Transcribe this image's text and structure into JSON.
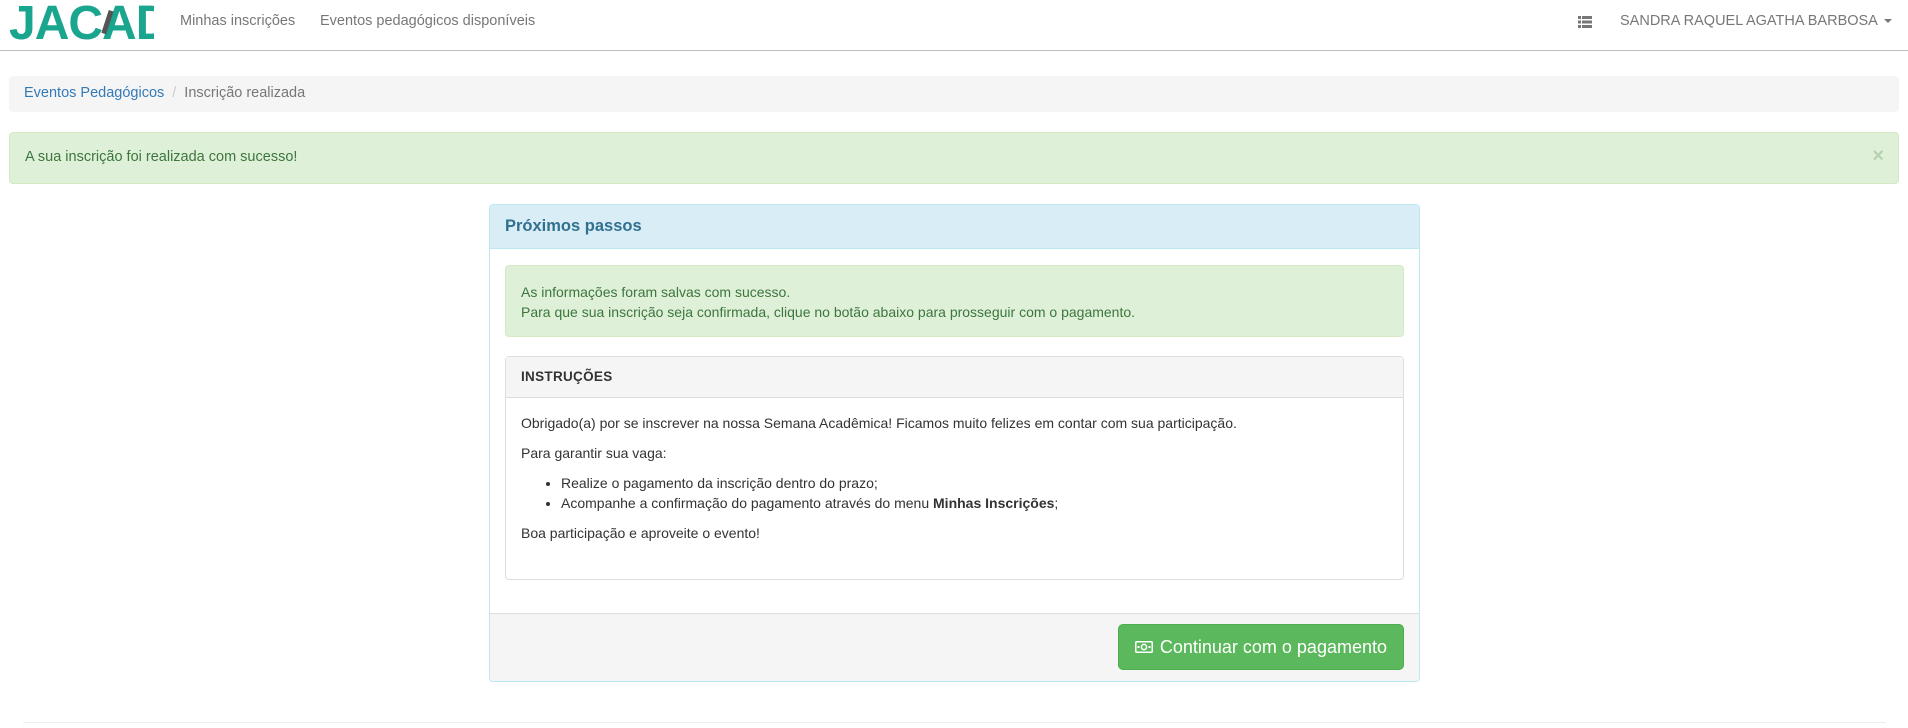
{
  "navbar": {
    "logo_text": "JACAD",
    "links": [
      {
        "label": "Minhas inscrições"
      },
      {
        "label": "Eventos pedagógicos disponíveis"
      }
    ],
    "list_icon": "list-icon",
    "user_name": "SANDRA RAQUEL AGATHA BARBOSA"
  },
  "breadcrumb": {
    "link": "Eventos Pedagógicos",
    "separator": "/",
    "active": "Inscrição realizada"
  },
  "alert_top": {
    "message": "A sua inscrição foi realizada com sucesso!",
    "close": "×"
  },
  "panel": {
    "title": "Próximos passos",
    "info_line_1": "As informações foram salvas com sucesso.",
    "info_line_2": "Para que sua inscrição seja confirmada, clique no botão abaixo para prosseguir com o pagamento.",
    "instructions": {
      "title": "INSTRUÇÕES",
      "intro": "Obrigado(a) por se inscrever na nossa Semana Acadêmica! Ficamos muito felizes em contar com sua participação.",
      "lead": "Para garantir sua vaga:",
      "item_1": "Realize o pagamento da inscrição dentro do prazo;",
      "item_2_prefix": "Acompanhe a confirmação do pagamento através do menu ",
      "item_2_bold": "Minhas Inscrições",
      "item_2_suffix": ";",
      "closing": "Boa participação e aproveite o evento!"
    },
    "button_label": "Continuar com o pagamento",
    "button_icon": "money-icon"
  },
  "colors": {
    "brand": "#1aa58f",
    "success_bg": "#dff0d8",
    "success_text": "#3c763d",
    "info_bg": "#d9edf7",
    "info_text": "#31708f",
    "button_green": "#5cb85c",
    "link_blue": "#337ab7"
  }
}
